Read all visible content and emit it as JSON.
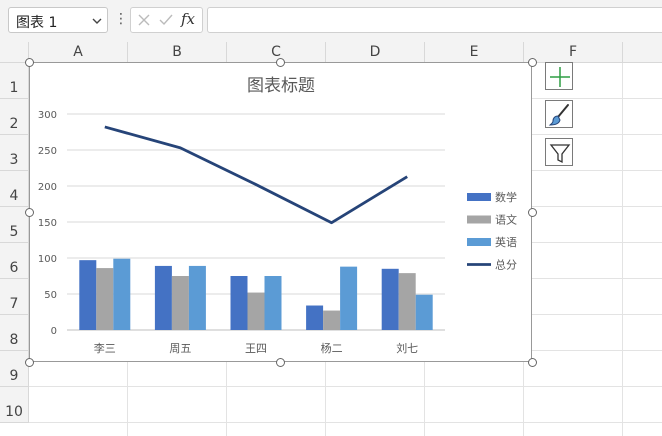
{
  "formula_bar": {
    "name_box": "图表 1",
    "more_icon": "more-vertical-icon",
    "cancel_icon": "cancel-x-icon",
    "enter_icon": "check-icon",
    "fx_label": "fx",
    "formula_value": ""
  },
  "sheet": {
    "columns": [
      "A",
      "B",
      "C",
      "D",
      "E",
      "F"
    ],
    "rows": [
      "1",
      "2",
      "3",
      "4",
      "5",
      "6",
      "7",
      "8",
      "9",
      "10"
    ]
  },
  "side_buttons": {
    "elements_icon": "plus-icon",
    "styles_icon": "paintbrush-icon",
    "filters_icon": "funnel-filter-icon"
  },
  "colors": {
    "math": "#4472c4",
    "chinese": "#a5a5a5",
    "english": "#5b9bd5",
    "total": "#264478",
    "plus_green": "#2e9e44"
  },
  "chart_data": {
    "type": "bar",
    "title": "图表标题",
    "categories": [
      "李三",
      "周五",
      "王四",
      "杨二",
      "刘七"
    ],
    "series": [
      {
        "name": "数学",
        "type": "bar",
        "values": [
          97,
          89,
          75,
          34,
          85
        ]
      },
      {
        "name": "语文",
        "type": "bar",
        "values": [
          86,
          75,
          52,
          27,
          79
        ]
      },
      {
        "name": "英语",
        "type": "bar",
        "values": [
          99,
          89,
          75,
          88,
          49
        ]
      },
      {
        "name": "总分",
        "type": "line",
        "values": [
          282,
          253,
          202,
          149,
          213
        ]
      }
    ],
    "y_ticks": [
      "0",
      "50",
      "100",
      "150",
      "200",
      "250",
      "300"
    ],
    "ylim": [
      0,
      300
    ],
    "grid": true,
    "legend_position": "right"
  }
}
